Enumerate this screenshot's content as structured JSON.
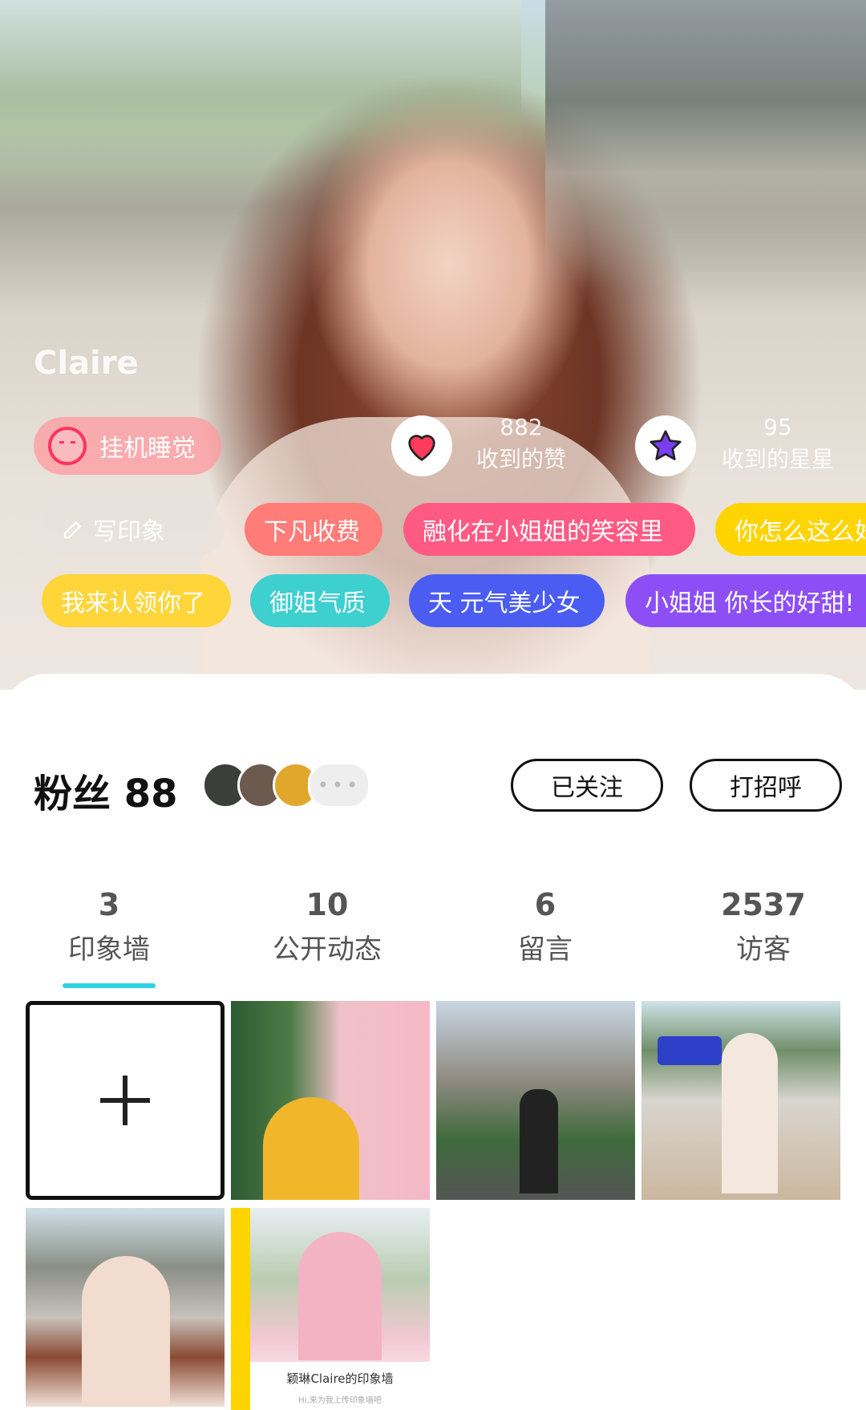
{
  "profile": {
    "name": "Claire",
    "status": "挂机睡觉"
  },
  "stats": {
    "likes_count": "882",
    "likes_label": "收到的赞",
    "stars_count": "95",
    "stars_label": "收到的星星"
  },
  "tags_row1": [
    {
      "text": "写印象",
      "color": "#e7e2de"
    },
    {
      "text": "下凡收费",
      "color": "#ff7c78"
    },
    {
      "text": "融化在小姐姐的笑容里",
      "color": "#ff5a84"
    },
    {
      "text": "你怎么这么好",
      "color": "#ffd400"
    }
  ],
  "tags_row2": [
    {
      "text": "我来认领你了",
      "color": "#ffd53a"
    },
    {
      "text": "御姐气质",
      "color": "#3ecfcf"
    },
    {
      "text": "天 元气美少女",
      "color": "#4a5cf2"
    },
    {
      "text": "小姐姐 你长的好甜!",
      "color": "#8d4ff5"
    }
  ],
  "fans": {
    "label": "粉丝 88",
    "more": "•••"
  },
  "buttons": {
    "following": "已关注",
    "greet": "打招呼"
  },
  "tabs": [
    {
      "count": "3",
      "label": "印象墙"
    },
    {
      "count": "10",
      "label": "公开动态"
    },
    {
      "count": "6",
      "label": "留言"
    },
    {
      "count": "2537",
      "label": "访客"
    }
  ],
  "wall": {
    "caption_title": "颖琳Claire的印象墙",
    "caption_sub": "Hi,来为我上传印象墙吧"
  },
  "colors": {
    "accent": "#2fd2e0",
    "like_heart": "#ff3b5c",
    "star": "#7b3df0"
  }
}
